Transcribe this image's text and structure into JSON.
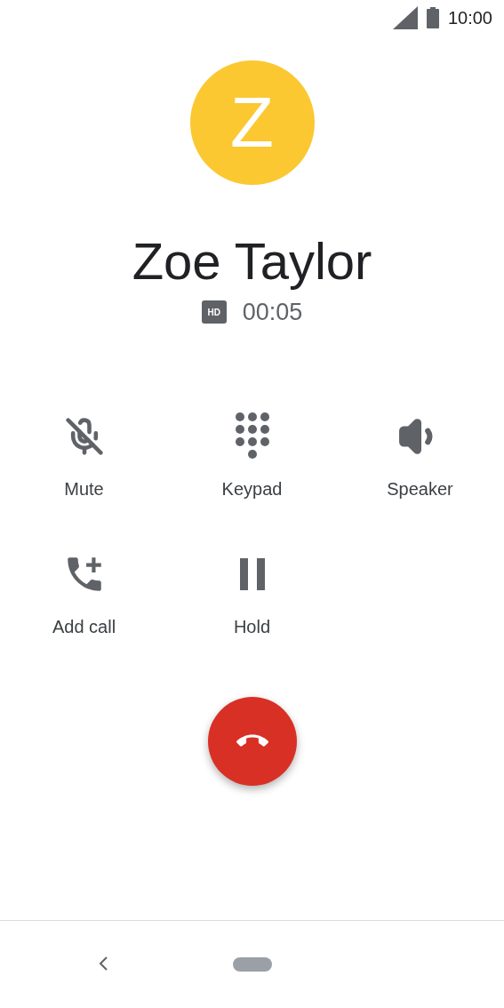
{
  "status_bar": {
    "time": "10:00"
  },
  "contact": {
    "initial": "Z",
    "color": "#fbc832",
    "name": "Zoe Taylor"
  },
  "call_info": {
    "badge": "HD",
    "duration": "00:05"
  },
  "actions": [
    {
      "kind": "mute",
      "label": "Mute"
    },
    {
      "kind": "keypad",
      "label": "Keypad"
    },
    {
      "kind": "speaker",
      "label": "Speaker"
    },
    {
      "kind": "add_call",
      "label": "Add call"
    },
    {
      "kind": "hold",
      "label": "Hold"
    }
  ],
  "end_call": {
    "color": "#d93025"
  }
}
